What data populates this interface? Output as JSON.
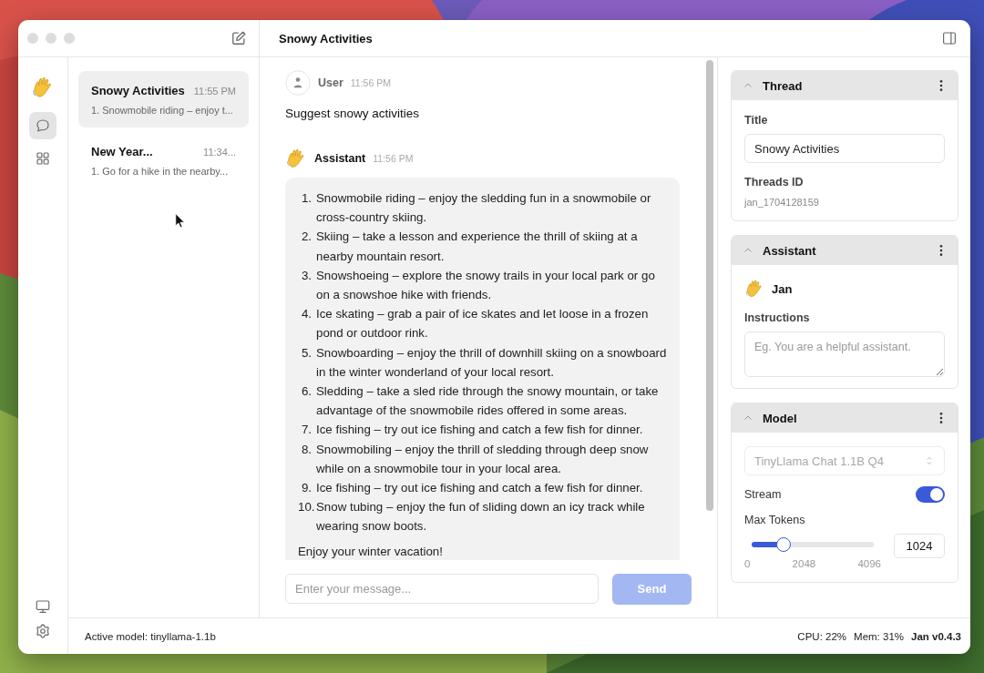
{
  "window": {
    "title": "Snowy Activities"
  },
  "rail": {
    "nav": [
      {
        "kind": "chat",
        "selected": true
      },
      {
        "kind": "apps",
        "selected": false
      }
    ],
    "bottom": [
      {
        "kind": "monitor"
      },
      {
        "kind": "settings"
      }
    ]
  },
  "threads": [
    {
      "title": "Snowy Activities",
      "time": "11:55 PM",
      "preview": "1. Snowmobile riding – enjoy t...",
      "selected": true
    },
    {
      "title": "New Year...",
      "time": "11:34...",
      "preview": "1. Go for a hike in the nearby...",
      "selected": false
    }
  ],
  "messages": [
    {
      "kind": "user",
      "author": "User",
      "time": "11:56 PM",
      "text": "Suggest snowy activities"
    },
    {
      "kind": "assistant",
      "author": "Assistant",
      "time": "11:56 PM",
      "items": [
        {
          "marker": "1.",
          "text": "Snowmobile riding – enjoy the sledding fun in a snowmobile or cross-country skiing."
        },
        {
          "marker": "2.",
          "text": "Skiing – take a lesson and experience the thrill of skiing at a nearby mountain resort."
        },
        {
          "marker": "3.",
          "text": "Snowshoeing – explore the snowy trails in your local park or go on a snowshoe hike with friends."
        },
        {
          "marker": "4.",
          "text": "Ice skating – grab a pair of ice skates and let loose in a frozen pond or outdoor rink."
        },
        {
          "marker": "5.",
          "text": "Snowboarding – enjoy the thrill of downhill skiing on a snowboard in the winter wonderland of your local resort."
        },
        {
          "marker": "6.",
          "text": "Sledding – take a sled ride through the snowy mountain, or take advantage of the snowmobile rides offered in some areas."
        },
        {
          "marker": "7.",
          "text": "Ice fishing – try out ice fishing and catch a few fish for dinner."
        },
        {
          "marker": "8.",
          "text": "Snowmobiling – enjoy the thrill of sledding through deep snow while on a snowmobile tour in your local area."
        },
        {
          "marker": "9.",
          "text": "Ice fishing – try out ice fishing and catch a few fish for dinner."
        },
        {
          "marker": "10.",
          "text": "Snow tubing – enjoy the fun of sliding down an icy track while wearing snow boots."
        }
      ],
      "closing": "Enjoy your winter vacation!"
    }
  ],
  "composer": {
    "placeholder": "Enter your message...",
    "send": "Send",
    "send_disabled": true
  },
  "panel": [
    {
      "kind": "thread",
      "heading": "Thread",
      "expanded": true,
      "title_label": "Title",
      "title_value": "Snowy Activities",
      "id_label": "Threads ID",
      "id_value": "jan_1704128159"
    },
    {
      "kind": "assistant",
      "heading": "Assistant",
      "expanded": true,
      "name": "Jan",
      "instructions_label": "Instructions",
      "instructions_placeholder": "Eg. You are a helpful assistant."
    },
    {
      "kind": "model",
      "heading": "Model",
      "expanded": true,
      "model": "TinyLlama Chat 1.1B Q4",
      "model_disabled": true,
      "stream_label": "Stream",
      "stream_on": true,
      "max_tokens_label": "Max Tokens",
      "level": 0.26,
      "ticks": [
        "0",
        "2048",
        "4096"
      ],
      "max_tokens_value": "1024"
    }
  ],
  "status_bar": {
    "active_model": "Active model: tinyllama-1.1b",
    "cpu": "CPU: 22%",
    "mem": "Mem: 31%",
    "version": "Jan v0.4.3"
  }
}
